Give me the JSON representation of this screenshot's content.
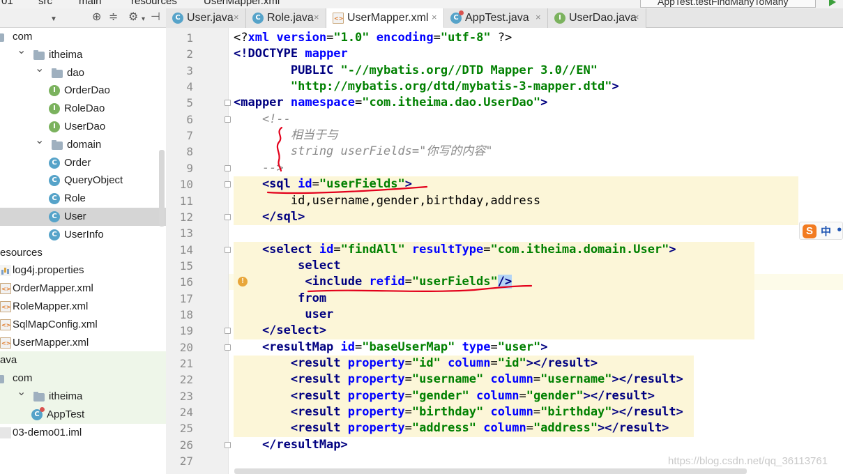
{
  "breadcrumb": {
    "items": [
      "01",
      "src",
      "main",
      "resources",
      "UserMapper.xml"
    ]
  },
  "run_config": {
    "label": "AppTest.testFindManyToMany"
  },
  "tabs": [
    {
      "label": "User.java",
      "icon": "class-icon"
    },
    {
      "label": "Role.java",
      "icon": "class-icon"
    },
    {
      "label": "UserMapper.xml",
      "icon": "xml-icon",
      "active": true
    },
    {
      "label": "AppTest.java",
      "icon": "test-class-icon"
    },
    {
      "label": "UserDao.java",
      "icon": "interface-icon"
    }
  ],
  "tree": [
    {
      "label": "com",
      "type": "folder"
    },
    {
      "label": "itheima",
      "type": "folder"
    },
    {
      "label": "dao",
      "type": "folder"
    },
    {
      "label": "OrderDao",
      "type": "interface",
      "glyph": "I"
    },
    {
      "label": "RoleDao",
      "type": "interface",
      "glyph": "I"
    },
    {
      "label": "UserDao",
      "type": "interface",
      "glyph": "I"
    },
    {
      "label": "domain",
      "type": "folder"
    },
    {
      "label": "Order",
      "type": "class",
      "glyph": "C"
    },
    {
      "label": "QueryObject",
      "type": "class",
      "glyph": "C"
    },
    {
      "label": "Role",
      "type": "class",
      "glyph": "C"
    },
    {
      "label": "User",
      "type": "class",
      "glyph": "C",
      "selected": true
    },
    {
      "label": "UserInfo",
      "type": "class",
      "glyph": "C"
    },
    {
      "label": "esources",
      "type": "resources-folder"
    },
    {
      "label": "log4j.properties",
      "type": "properties"
    },
    {
      "label": "OrderMapper.xml",
      "type": "xml"
    },
    {
      "label": "RoleMapper.xml",
      "type": "xml"
    },
    {
      "label": "SqlMapConfig.xml",
      "type": "xml"
    },
    {
      "label": "UserMapper.xml",
      "type": "xml"
    },
    {
      "label": "ava",
      "type": "test-root"
    },
    {
      "label": "com",
      "type": "folder"
    },
    {
      "label": "itheima",
      "type": "folder"
    },
    {
      "label": "AppTest",
      "type": "test-class",
      "glyph": "C"
    },
    {
      "label": "03-demo01.iml",
      "type": "iml"
    }
  ],
  "code_lines": [
    [
      {
        "t": "<?",
        "c": "pi"
      },
      {
        "t": "xml ",
        "c": "attr"
      },
      {
        "t": "version",
        "c": "attr"
      },
      {
        "t": "=",
        "c": "plain"
      },
      {
        "t": "\"1.0\"",
        "c": "val"
      },
      {
        "t": " encoding",
        "c": "attr"
      },
      {
        "t": "=",
        "c": "plain"
      },
      {
        "t": "\"utf-8\"",
        "c": "val"
      },
      {
        "t": " ?>",
        "c": "pi"
      }
    ],
    [
      {
        "t": "<!DOCTYPE ",
        "c": "tag"
      },
      {
        "t": "mapper",
        "c": "attr"
      }
    ],
    [
      {
        "t": "        PUBLIC ",
        "c": "tag"
      },
      {
        "t": "\"-//mybatis.org//DTD Mapper 3.0//EN\"",
        "c": "val"
      }
    ],
    [
      {
        "t": "        ",
        "c": "plain"
      },
      {
        "t": "\"http://mybatis.org/dtd/mybatis-3-mapper.dtd\"",
        "c": "val"
      },
      {
        "t": ">",
        "c": "tag"
      }
    ],
    [
      {
        "t": "<mapper ",
        "c": "tag"
      },
      {
        "t": "namespace",
        "c": "attr"
      },
      {
        "t": "=",
        "c": "plain"
      },
      {
        "t": "\"com.itheima.dao.UserDao\"",
        "c": "val"
      },
      {
        "t": ">",
        "c": "tag"
      }
    ],
    [
      {
        "t": "    <!--",
        "c": "cmt"
      }
    ],
    [
      {
        "t": "        相当于与",
        "c": "cmt"
      }
    ],
    [
      {
        "t": "        string userFields=\"你写的内容\"",
        "c": "cmt"
      }
    ],
    [
      {
        "t": "    -->",
        "c": "cmt"
      }
    ],
    [
      {
        "t": "    <sql ",
        "c": "tag"
      },
      {
        "t": "id",
        "c": "attr"
      },
      {
        "t": "=",
        "c": "plain"
      },
      {
        "t": "\"userFields\"",
        "c": "val"
      },
      {
        "t": ">",
        "c": "tag"
      }
    ],
    [
      {
        "t": "        id,username,gender,birthday,address",
        "c": "plain"
      }
    ],
    [
      {
        "t": "    </sql>",
        "c": "tag"
      }
    ],
    [
      {
        "t": "",
        "c": "plain"
      }
    ],
    [
      {
        "t": "    <select ",
        "c": "tag"
      },
      {
        "t": "id",
        "c": "attr"
      },
      {
        "t": "=",
        "c": "plain"
      },
      {
        "t": "\"findAll\"",
        "c": "val"
      },
      {
        "t": " resultType",
        "c": "attr"
      },
      {
        "t": "=",
        "c": "plain"
      },
      {
        "t": "\"com.itheima.domain.User\"",
        "c": "val"
      },
      {
        "t": ">",
        "c": "tag"
      }
    ],
    [
      {
        "t": "         select",
        "c": "kw"
      }
    ],
    [
      {
        "t": "          <include ",
        "c": "tag"
      },
      {
        "t": "refid",
        "c": "attr"
      },
      {
        "t": "=",
        "c": "plain"
      },
      {
        "t": "\"userFields\"",
        "c": "val"
      },
      {
        "t": "/>",
        "c": "sel"
      }
    ],
    [
      {
        "t": "         from",
        "c": "kw"
      }
    ],
    [
      {
        "t": "          user",
        "c": "kw"
      }
    ],
    [
      {
        "t": "    </select>",
        "c": "tag"
      }
    ],
    [
      {
        "t": "    <resultMap ",
        "c": "tag"
      },
      {
        "t": "id",
        "c": "attr"
      },
      {
        "t": "=",
        "c": "plain"
      },
      {
        "t": "\"baseUserMap\"",
        "c": "val"
      },
      {
        "t": " type",
        "c": "attr"
      },
      {
        "t": "=",
        "c": "plain"
      },
      {
        "t": "\"user\"",
        "c": "val"
      },
      {
        "t": ">",
        "c": "tag"
      }
    ],
    [
      {
        "t": "        <result ",
        "c": "tag"
      },
      {
        "t": "property",
        "c": "attr"
      },
      {
        "t": "=",
        "c": "plain"
      },
      {
        "t": "\"id\"",
        "c": "val"
      },
      {
        "t": " column",
        "c": "attr"
      },
      {
        "t": "=",
        "c": "plain"
      },
      {
        "t": "\"id\"",
        "c": "val"
      },
      {
        "t": "></result>",
        "c": "tag"
      }
    ],
    [
      {
        "t": "        <result ",
        "c": "tag"
      },
      {
        "t": "property",
        "c": "attr"
      },
      {
        "t": "=",
        "c": "plain"
      },
      {
        "t": "\"username\"",
        "c": "val"
      },
      {
        "t": " column",
        "c": "attr"
      },
      {
        "t": "=",
        "c": "plain"
      },
      {
        "t": "\"username\"",
        "c": "val"
      },
      {
        "t": "></result>",
        "c": "tag"
      }
    ],
    [
      {
        "t": "        <result ",
        "c": "tag"
      },
      {
        "t": "property",
        "c": "attr"
      },
      {
        "t": "=",
        "c": "plain"
      },
      {
        "t": "\"gender\"",
        "c": "val"
      },
      {
        "t": " column",
        "c": "attr"
      },
      {
        "t": "=",
        "c": "plain"
      },
      {
        "t": "\"gender\"",
        "c": "val"
      },
      {
        "t": "></result>",
        "c": "tag"
      }
    ],
    [
      {
        "t": "        <result ",
        "c": "tag"
      },
      {
        "t": "property",
        "c": "attr"
      },
      {
        "t": "=",
        "c": "plain"
      },
      {
        "t": "\"birthday\"",
        "c": "val"
      },
      {
        "t": " column",
        "c": "attr"
      },
      {
        "t": "=",
        "c": "plain"
      },
      {
        "t": "\"birthday\"",
        "c": "val"
      },
      {
        "t": "></result>",
        "c": "tag"
      }
    ],
    [
      {
        "t": "        <result ",
        "c": "tag"
      },
      {
        "t": "property",
        "c": "attr"
      },
      {
        "t": "=",
        "c": "plain"
      },
      {
        "t": "\"address\"",
        "c": "val"
      },
      {
        "t": " column",
        "c": "attr"
      },
      {
        "t": "=",
        "c": "plain"
      },
      {
        "t": "\"address\"",
        "c": "val"
      },
      {
        "t": "></result>",
        "c": "tag"
      }
    ],
    [
      {
        "t": "    </resultMap>",
        "c": "tag"
      }
    ],
    [
      {
        "t": "",
        "c": "plain"
      }
    ]
  ],
  "line_numbers": [
    "1",
    "2",
    "3",
    "4",
    "5",
    "6",
    "7",
    "8",
    "9",
    "10",
    "11",
    "12",
    "13",
    "14",
    "15",
    "16",
    "17",
    "18",
    "19",
    "20",
    "21",
    "22",
    "23",
    "24",
    "25",
    "26",
    "27"
  ],
  "current_line": 16,
  "ime": {
    "logo": "S",
    "mode": "中",
    "dot": "•"
  },
  "watermark": "https://blog.csdn.net/qq_36113761",
  "colors": {
    "tag": "#000080",
    "attr": "#0000ff",
    "value": "#008000",
    "comment": "#8c8c8c",
    "highlight": "#fcf6d8",
    "annotation": "#e3001b"
  }
}
